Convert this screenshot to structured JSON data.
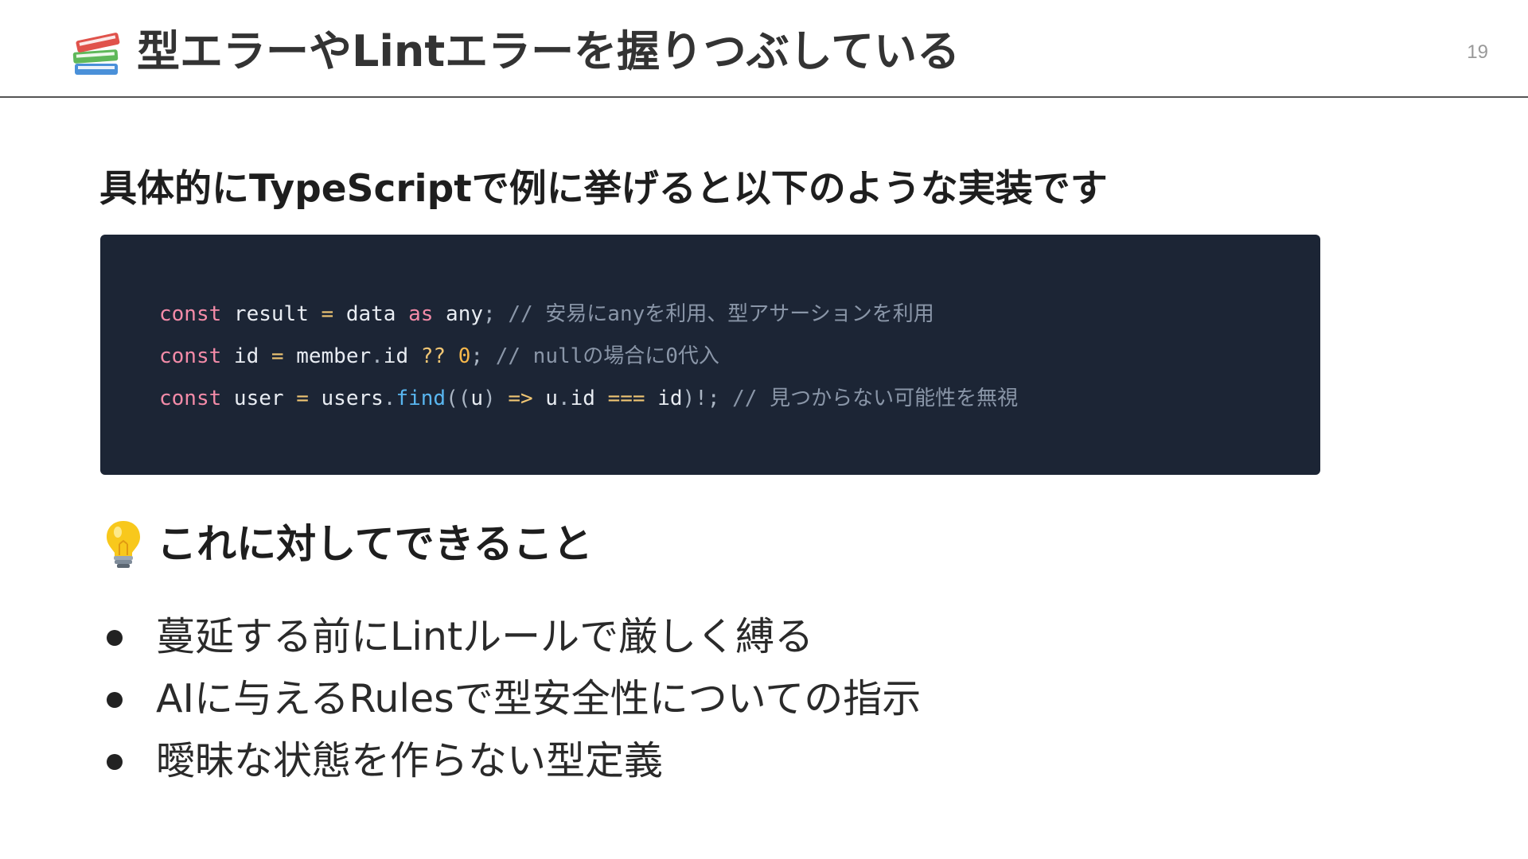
{
  "header": {
    "title_icon": "books-icon",
    "title": "型エラーやLintエラーを握りつぶしている",
    "page_number": "19"
  },
  "subheading": "具体的にTypeScriptで例に挙げると以下のような実装です",
  "code": {
    "lines": [
      {
        "tokens": [
          {
            "text": "const",
            "kind": "kw"
          },
          {
            "text": " result ",
            "kind": "plain"
          },
          {
            "text": "=",
            "kind": "op"
          },
          {
            "text": " data ",
            "kind": "plain"
          },
          {
            "text": "as",
            "kind": "kw"
          },
          {
            "text": " any",
            "kind": "plain"
          },
          {
            "text": ";",
            "kind": "pn"
          },
          {
            "text": " // 安易にanyを利用、型アサーションを利用",
            "kind": "cm"
          }
        ]
      },
      {
        "tokens": [
          {
            "text": "const",
            "kind": "kw"
          },
          {
            "text": " id ",
            "kind": "plain"
          },
          {
            "text": "=",
            "kind": "op"
          },
          {
            "text": " member",
            "kind": "plain"
          },
          {
            "text": ".",
            "kind": "pn"
          },
          {
            "text": "id ",
            "kind": "plain"
          },
          {
            "text": "??",
            "kind": "op"
          },
          {
            "text": " ",
            "kind": "plain"
          },
          {
            "text": "0",
            "kind": "num"
          },
          {
            "text": ";",
            "kind": "pn"
          },
          {
            "text": " // nullの場合に0代入",
            "kind": "cm"
          }
        ]
      },
      {
        "tokens": [
          {
            "text": "const",
            "kind": "kw"
          },
          {
            "text": " user ",
            "kind": "plain"
          },
          {
            "text": "=",
            "kind": "op"
          },
          {
            "text": " users",
            "kind": "plain"
          },
          {
            "text": ".",
            "kind": "pn"
          },
          {
            "text": "find",
            "kind": "fn"
          },
          {
            "text": "((",
            "kind": "pn"
          },
          {
            "text": "u",
            "kind": "plain"
          },
          {
            "text": ")",
            "kind": "pn"
          },
          {
            "text": " ",
            "kind": "plain"
          },
          {
            "text": "=>",
            "kind": "op"
          },
          {
            "text": " u",
            "kind": "plain"
          },
          {
            "text": ".",
            "kind": "pn"
          },
          {
            "text": "id ",
            "kind": "plain"
          },
          {
            "text": "===",
            "kind": "op"
          },
          {
            "text": " id",
            "kind": "plain"
          },
          {
            "text": ")!",
            "kind": "pn"
          },
          {
            "text": ";",
            "kind": "pn"
          },
          {
            "text": " // 見つからない可能性を無視",
            "kind": "cm"
          }
        ]
      }
    ]
  },
  "tip": {
    "icon": "lightbulb-icon",
    "heading": "これに対してできること"
  },
  "bullets": [
    "蔓延する前にLintルールで厳しく縛る",
    "AIに与えるRulesで型安全性についての指示",
    "曖昧な状態を作らない型定義"
  ],
  "colors": {
    "code_background": "#1c2535",
    "keyword": "#f38ba8",
    "operator": "#f0c674",
    "number": "#f7b84b",
    "function": "#59b6f0",
    "comment": "#8a96a8"
  }
}
